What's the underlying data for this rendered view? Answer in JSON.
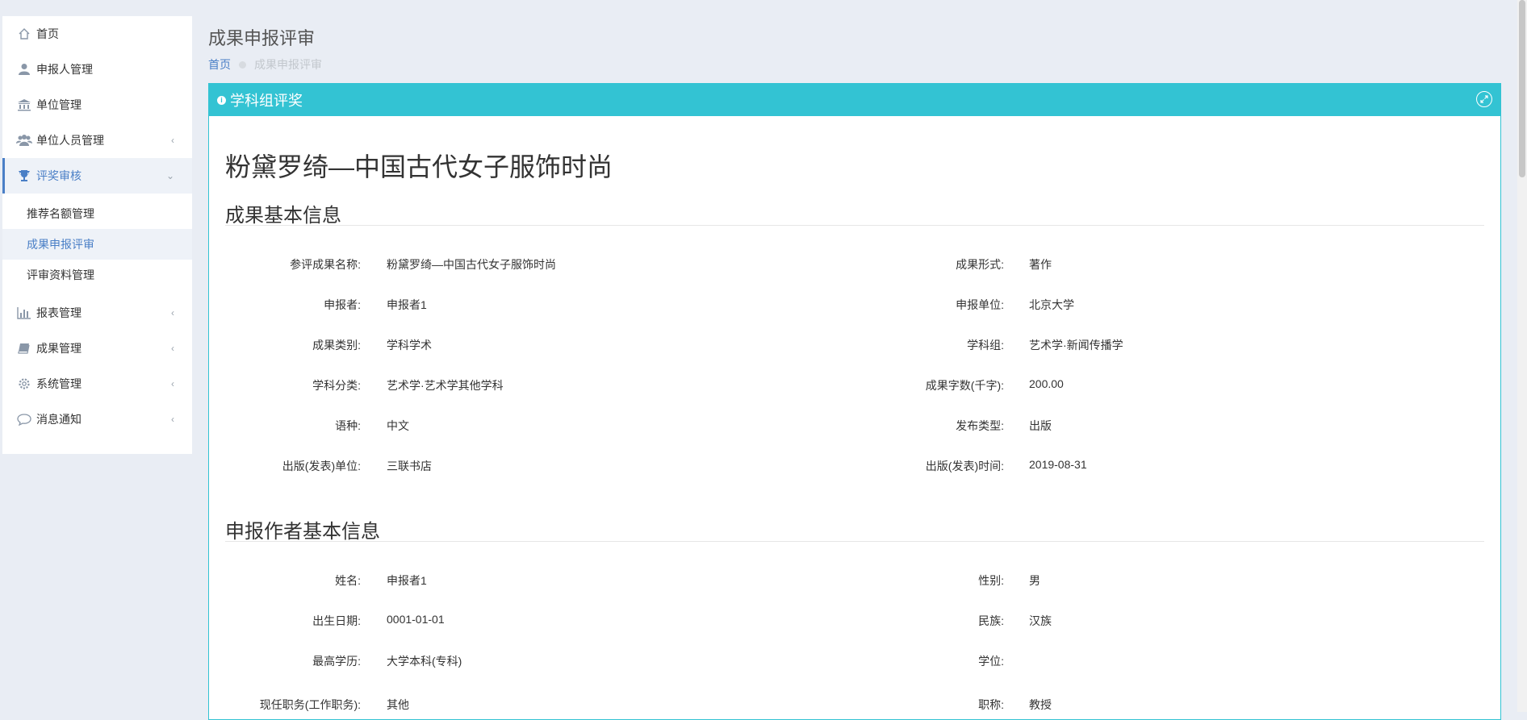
{
  "sidebar": {
    "items": [
      {
        "label": "首页",
        "icon": "home-icon"
      },
      {
        "label": "申报人管理",
        "icon": "user-icon"
      },
      {
        "label": "单位管理",
        "icon": "bank-icon"
      },
      {
        "label": "单位人员管理",
        "icon": "users-icon",
        "chevron": "‹"
      },
      {
        "label": "评奖审核",
        "icon": "trophy-icon",
        "chevron": "⌄"
      },
      {
        "label": "报表管理",
        "icon": "bar-chart-icon",
        "chevron": "‹"
      },
      {
        "label": "成果管理",
        "icon": "book-icon",
        "chevron": "‹"
      },
      {
        "label": "系统管理",
        "icon": "gear-icon",
        "chevron": "‹"
      },
      {
        "label": "消息通知",
        "icon": "comment-icon",
        "chevron": "‹"
      }
    ],
    "sub_items": [
      {
        "label": "推荐名额管理"
      },
      {
        "label": "成果申报评审"
      },
      {
        "label": "评审资料管理"
      }
    ]
  },
  "header": {
    "title": "成果申报评审",
    "breadcrumb_home": "首页",
    "breadcrumb_current": "成果申报评审"
  },
  "panel": {
    "title": "学科组评奖",
    "doc_title": "粉黛罗绮—中国古代女子服饰时尚",
    "section1_title": "成果基本信息",
    "section2_title": "申报作者基本信息",
    "basic_info": [
      {
        "l_label": "参评成果名称:",
        "l_value": "粉黛罗绮—中国古代女子服饰时尚",
        "r_label": "成果形式:",
        "r_value": "著作"
      },
      {
        "l_label": "申报者:",
        "l_value": "申报者1",
        "r_label": "申报单位:",
        "r_value": "北京大学"
      },
      {
        "l_label": "成果类别:",
        "l_value": "学科学术",
        "r_label": "学科组:",
        "r_value": "艺术学·新闻传播学"
      },
      {
        "l_label": "学科分类:",
        "l_value": "艺术学·艺术学其他学科",
        "r_label": "成果字数(千字):",
        "r_value": "200.00"
      },
      {
        "l_label": "语种:",
        "l_value": "中文",
        "r_label": "发布类型:",
        "r_value": "出版"
      },
      {
        "l_label": "出版(发表)单位:",
        "l_value": "三联书店",
        "r_label": "出版(发表)时间:",
        "r_value": "2019-08-31"
      }
    ],
    "author_info": [
      {
        "l_label": "姓名:",
        "l_value": "申报者1",
        "r_label": "性别:",
        "r_value": "男"
      },
      {
        "l_label": "出生日期:",
        "l_value": "0001-01-01",
        "r_label": "民族:",
        "r_value": "汉族"
      },
      {
        "l_label": "最高学历:",
        "l_value": "大学本科(专科)",
        "r_label": "学位:",
        "r_value": ""
      },
      {
        "l_label": "现任职务(工作职务):",
        "l_value": "其他",
        "r_label": "职称:",
        "r_value": "教授"
      }
    ]
  },
  "colors": {
    "accent": "#33c3d3",
    "link": "#4a7fc6",
    "background": "#e9edf4"
  }
}
